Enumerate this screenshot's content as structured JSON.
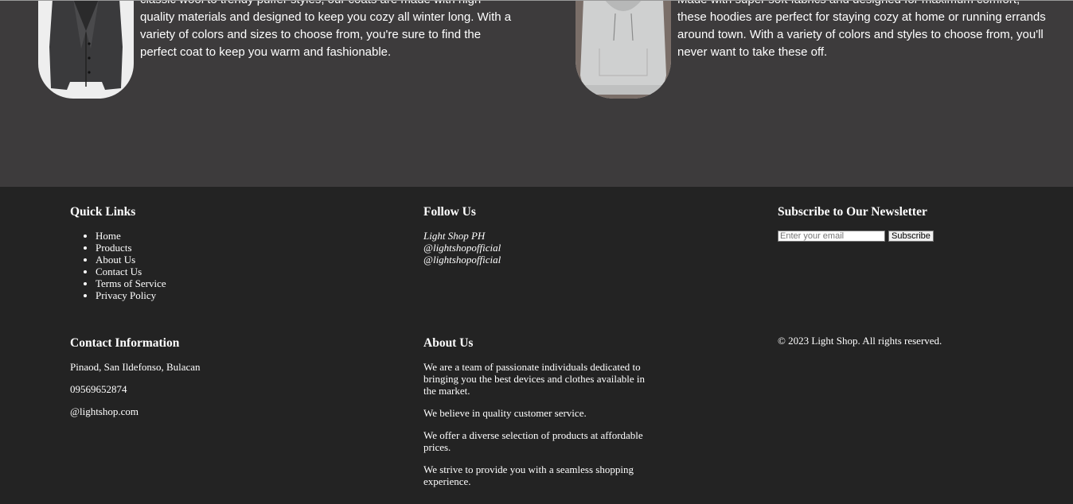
{
  "products": {
    "coat": {
      "description": "classic wool to trendy puffer styles, our coats are made with high-quality materials and designed to keep you cozy all winter long. With a variety of colors and sizes to choose from, you're sure to find the perfect coat to keep you warm and fashionable."
    },
    "hoodie": {
      "description": "Made with super soft fabrics and designed for maximum comfort, these hoodies are perfect for staying cozy at home or running errands around town. With a variety of colors and styles to choose from, you'll never want to take these off."
    }
  },
  "footer": {
    "quick_links": {
      "title": "Quick Links",
      "items": [
        "Home",
        "Products",
        "About Us",
        "Contact Us",
        "Terms of Service",
        "Privacy Policy"
      ]
    },
    "follow_us": {
      "title": "Follow Us",
      "items": [
        "Light Shop PH",
        "@lightshopofficial",
        "@lightshopofficial"
      ]
    },
    "newsletter": {
      "title": "Subscribe to Our Newsletter",
      "placeholder": "Enter your email",
      "button": "Subscribe"
    },
    "contact": {
      "title": "Contact Information",
      "address": "Pinaod, San Ildefonso, Bulacan",
      "phone": "09569652874",
      "handle": "@lightshop.com"
    },
    "about": {
      "title": "About Us",
      "paragraphs": [
        "We are a team of passionate individuals dedicated to bringing you the best devices and clothes available in the market.",
        "We believe in quality customer service.",
        "We offer a diverse selection of products at affordable prices.",
        "We strive to provide you with a seamless shopping experience."
      ]
    },
    "copyright": "© 2023 Light Shop. All rights reserved."
  }
}
